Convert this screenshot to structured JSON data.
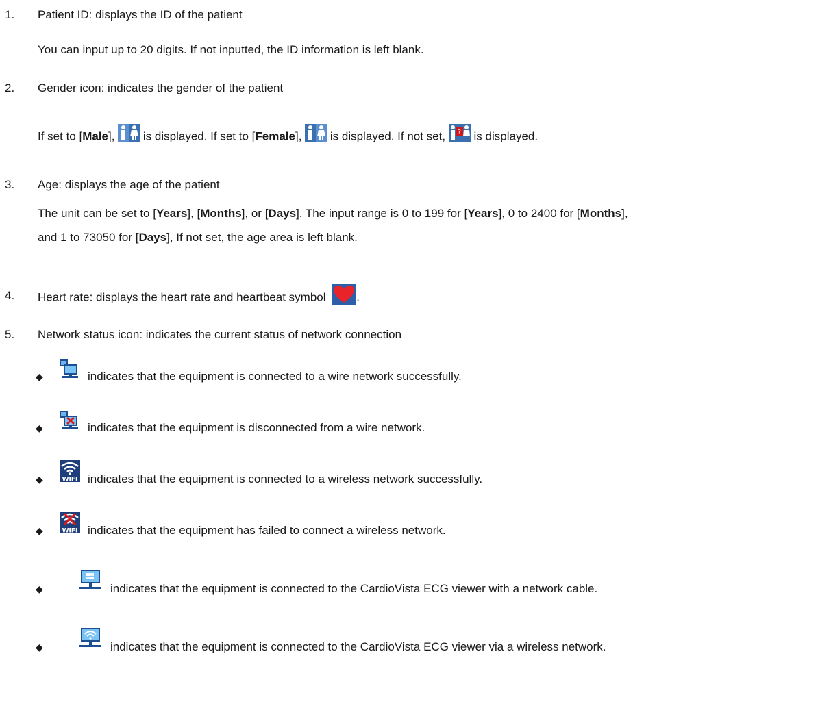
{
  "items": [
    {
      "num": "1.",
      "title": "Patient ID: displays the ID of the patient",
      "desc": "You can input up to 20 digits. If not inputted, the ID information is left blank."
    },
    {
      "num": "2.",
      "title": "Gender icon: indicates the gender of the patient",
      "desc_parts": {
        "p1": "If set to [",
        "male": "Male",
        "p2": "], ",
        "p3": " is displayed. If set to [",
        "female": "Female",
        "p4": "], ",
        "p5": " is displayed. If not set, ",
        "p6": " is displayed."
      }
    },
    {
      "num": "3.",
      "title": "Age: displays the age of the patient",
      "desc_parts": {
        "l1a": "The unit can be set to [",
        "years": "Years",
        "l1b": "], [",
        "months": "Months",
        "l1c": "], or [",
        "days": "Days",
        "l1d": "]. The input range is 0 to 199 for [",
        "l1e": "], 0 to 2400 for [",
        "l1f": "],",
        "l2a": "and 1 to 73050 for [",
        "l2b": "], If not set, the age area is left blank."
      }
    },
    {
      "num": "4.",
      "title": "Heart rate: displays the heart rate and heartbeat symbol",
      "tail": "."
    },
    {
      "num": "5.",
      "title": "Network status icon: indicates the current status of network connection"
    }
  ],
  "network_statuses": [
    {
      "icon": "wired-connected-icon",
      "text": "indicates that the equipment is connected to a wire network successfully."
    },
    {
      "icon": "wired-disconnected-icon",
      "text": "indicates that the equipment is disconnected from a wire network."
    },
    {
      "icon": "wifi-connected-icon",
      "text": "indicates that the equipment is connected to a wireless network successfully."
    },
    {
      "icon": "wifi-failed-icon",
      "text": "indicates that the equipment has failed to connect a wireless network."
    },
    {
      "icon": "viewer-cable-icon",
      "text": "indicates that the equipment is connected to the CardioVista ECG viewer with a network cable."
    },
    {
      "icon": "viewer-wireless-icon",
      "text": "indicates that the equipment is connected to the CardioVista ECG viewer via a wireless network."
    }
  ],
  "bullet_glyph": "◆"
}
